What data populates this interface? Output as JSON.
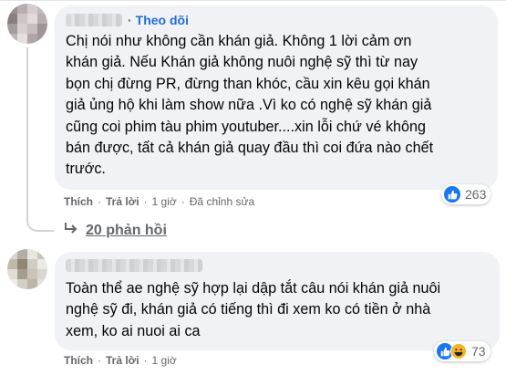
{
  "comments": [
    {
      "follow_label": "Theo dõi",
      "text_lines": [
        "Chị nói như không cần khán giả. Không 1 lời cảm ơn",
        "khán giả. Nếu Khán giả không nuôi nghệ sỹ thì từ nay",
        "bọn chị đừng PR, đừng than khóc, cầu xin kêu gọi khán",
        "giả ủng hộ khi làm show nữa .Vì ko có nghệ sỹ khán giả",
        "cũng coi phim tàu phim youtuber....xin lỗi chứ vé không",
        "bán được, tất cả khán giả quay đầu thì coi đứa nào chết",
        "trước."
      ],
      "like_label": "Thích",
      "reply_label": "Trả lời",
      "time": "1 giờ",
      "edited": "Đã chỉnh sửa",
      "reaction_count": "263",
      "reaction_icon": "like-icon",
      "replies_label": "20 phản hồi"
    },
    {
      "text_lines": [
        "Toàn thể ae nghệ sỹ hợp lại dập tắt câu nói khán giả nuôi",
        "nghệ sỹ đi, khán giả có tiếng thì đi xem ko có tiền ở nhà",
        "xem, ko ai nuoi ai ca"
      ],
      "like_label": "Thích",
      "reply_label": "Trả lời",
      "time": "1 giờ",
      "reaction_count": "73",
      "reaction_icons": [
        "like-icon",
        "haha-icon"
      ]
    }
  ],
  "colors": {
    "bubble": "#f0f2f5",
    "follow": "#216fdb",
    "meta": "#65676b",
    "like": "#1877f2",
    "haha": "#f7b125"
  }
}
